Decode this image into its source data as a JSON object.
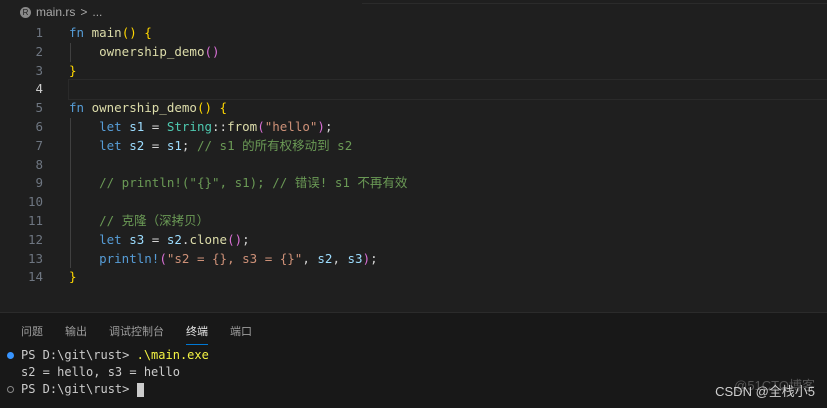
{
  "breadcrumb": {
    "file": "main.rs",
    "sep": ">",
    "more": "..."
  },
  "code": [
    [
      [
        "kw",
        "fn "
      ],
      [
        "fnn",
        "main"
      ],
      [
        "b1",
        "() {"
      ]
    ],
    [
      [
        "pl",
        "    "
      ],
      [
        "fnn",
        "ownership_demo"
      ],
      [
        "b2",
        "()"
      ]
    ],
    [
      [
        "b1",
        "}"
      ]
    ],
    [],
    [
      [
        "kw",
        "fn "
      ],
      [
        "fnn",
        "ownership_demo"
      ],
      [
        "b1",
        "() {"
      ]
    ],
    [
      [
        "pl",
        "    "
      ],
      [
        "kw",
        "let "
      ],
      [
        "var",
        "s1"
      ],
      [
        "pl",
        " = "
      ],
      [
        "ty",
        "String"
      ],
      [
        "pl",
        "::"
      ],
      [
        "fnn",
        "from"
      ],
      [
        "b2",
        "("
      ],
      [
        "str",
        "\"hello\""
      ],
      [
        "b2",
        ")"
      ],
      [
        "pl",
        ";"
      ]
    ],
    [
      [
        "pl",
        "    "
      ],
      [
        "kw",
        "let "
      ],
      [
        "var",
        "s2"
      ],
      [
        "pl",
        " = "
      ],
      [
        "var",
        "s1"
      ],
      [
        "pl",
        "; "
      ],
      [
        "cm",
        "// s1 的所有权移动到 s2"
      ]
    ],
    [],
    [
      [
        "pl",
        "    "
      ],
      [
        "cm",
        "// println!(\"{}\", s1); // 错误! s1 不再有效"
      ]
    ],
    [],
    [
      [
        "pl",
        "    "
      ],
      [
        "cm",
        "// 克隆（深拷贝）"
      ]
    ],
    [
      [
        "pl",
        "    "
      ],
      [
        "kw",
        "let "
      ],
      [
        "var",
        "s3"
      ],
      [
        "pl",
        " = "
      ],
      [
        "var",
        "s2"
      ],
      [
        "pl",
        "."
      ],
      [
        "fnn",
        "clone"
      ],
      [
        "b2",
        "()"
      ],
      [
        "pl",
        ";"
      ]
    ],
    [
      [
        "pl",
        "    "
      ],
      [
        "mac",
        "println!"
      ],
      [
        "b2",
        "("
      ],
      [
        "str",
        "\"s2 = {}, s3 = {}\""
      ],
      [
        "pl",
        ", "
      ],
      [
        "var",
        "s2"
      ],
      [
        "pl",
        ", "
      ],
      [
        "var",
        "s3"
      ],
      [
        "b2",
        ")"
      ],
      [
        "pl",
        ";"
      ]
    ],
    [
      [
        "b1",
        "}"
      ]
    ]
  ],
  "panel": {
    "tabs": [
      "问题",
      "输出",
      "调试控制台",
      "终端",
      "端口"
    ],
    "active": 3
  },
  "terminal": {
    "prompt1": "PS D:\\git\\rust> ",
    "cmd1": ".\\main.exe",
    "output": "s2 = hello, s3 = hello",
    "prompt2": "PS D:\\git\\rust> "
  },
  "watermark": "CSDN @全栈小5",
  "watermark2": "@51CTO博客"
}
